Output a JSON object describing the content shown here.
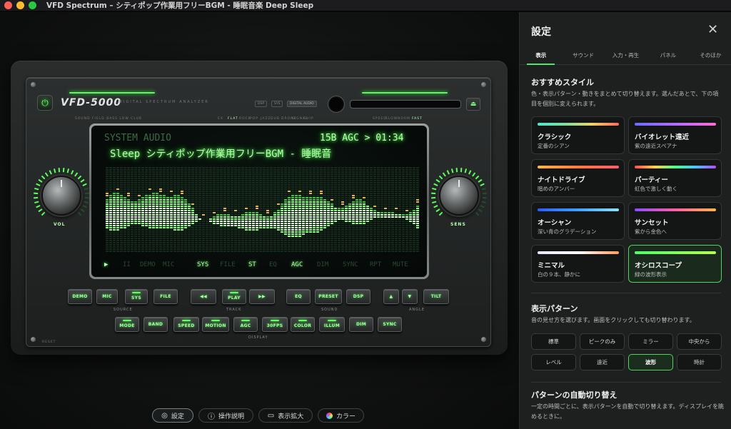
{
  "window": {
    "title": "VFD Spectrum – シティポップ作業用フリーBGM - 睡眠音楽 Deep Sleep"
  },
  "device": {
    "brand": "VFD-5000",
    "subtitle": "DIGITAL SPECTRUM ANALYZER",
    "header_chips": [
      "DSP",
      "SYS",
      "DIGITAL AUDIO"
    ],
    "left_micro": "SOUND FIELD  BASS  LOW  CLUB",
    "mid_micro": [
      "EX",
      "FLAT",
      "ROCK",
      "POP",
      "JAZZ",
      "DUB",
      "DRONE",
      "SIGNAL",
      "CHIP"
    ],
    "right_micro": [
      "SPEED",
      "SLOW",
      "NORM",
      "FAST"
    ],
    "reset_label": "RESET",
    "knob_left": "VOL",
    "knob_right": "SENS"
  },
  "vfd": {
    "source": "SYSTEM AUDIO",
    "band_info": "15B AGC > 01:34",
    "track": "Sleep  シティポップ作業用フリーBGM - 睡眠音",
    "status": [
      {
        "label": "▶",
        "on": true
      },
      {
        "label": "II",
        "on": false
      },
      {
        "label": "DEMO",
        "on": false
      },
      {
        "label": "MIC",
        "on": false
      },
      {
        "label": "SYS",
        "on": true
      },
      {
        "label": "FILE",
        "on": false
      },
      {
        "label": "ST",
        "on": true
      },
      {
        "label": "EQ",
        "on": false
      },
      {
        "label": "AGC",
        "on": true
      },
      {
        "label": "DIM",
        "on": false
      },
      {
        "label": "SYNC",
        "on": false
      },
      {
        "label": "RPT",
        "on": false
      },
      {
        "label": "MUTE",
        "on": false
      }
    ]
  },
  "controls": {
    "row1": [
      {
        "label": "DEMO",
        "lit": false
      },
      {
        "label": "MIC",
        "lit": false
      },
      {
        "label": "SYS",
        "lit": true
      },
      {
        "label": "FILE",
        "lit": false
      },
      {
        "label": "◀◀",
        "lit": false
      },
      {
        "label": "PLAY",
        "lit": true
      },
      {
        "label": "▶▶",
        "lit": false
      },
      {
        "label": "EQ",
        "lit": false
      },
      {
        "label": "PRESET",
        "lit": false
      },
      {
        "label": "DSP",
        "lit": false
      },
      {
        "label": "▲",
        "lit": false
      },
      {
        "label": "▼",
        "lit": false
      },
      {
        "label": "TILT",
        "lit": false
      }
    ],
    "row2": [
      {
        "label": "MODE",
        "lit": true
      },
      {
        "label": "BAND",
        "lit": false
      },
      {
        "label": "SPEED",
        "lit": true
      },
      {
        "label": "MOTION",
        "lit": true
      },
      {
        "label": "AGC",
        "lit": true
      },
      {
        "label": "30FPS",
        "lit": true
      },
      {
        "label": "COLOR",
        "lit": true
      },
      {
        "label": "ILLUM",
        "lit": true
      },
      {
        "label": "DIM",
        "lit": false
      },
      {
        "label": "SYNC",
        "lit": false
      }
    ],
    "groups": {
      "source": "SOURCE",
      "track": "TRACK",
      "sound": "SOUND",
      "angle": "ANGLE",
      "display": "DISPLAY"
    }
  },
  "toolbar": {
    "settings": "設定",
    "help": "操作説明",
    "zoom": "表示拡大",
    "color": "カラー"
  },
  "panel": {
    "title": "設定",
    "tabs": [
      "表示",
      "サウンド",
      "入力・再生",
      "パネル",
      "そのほか"
    ],
    "recommended": {
      "title": "おすすめスタイル",
      "desc": "色・表示パターン・動きをまとめて切り替えます。選んだあとで、下の項目を個別に変えられます。",
      "cards": [
        {
          "name": "クラシック",
          "desc": "定番のシアン",
          "gradient": "linear-gradient(90deg,#4ee6c9,#7de0a0,#f2d36b,#ff6b5b)",
          "active": false
        },
        {
          "name": "バイオレット遠近",
          "desc": "紫の遠近スペアナ",
          "gradient": "linear-gradient(90deg,#6b6bff,#b36bff,#ff6bd6)",
          "active": false
        },
        {
          "name": "ナイトドライブ",
          "desc": "暗めのアンバー",
          "gradient": "linear-gradient(90deg,#ffb347,#ff7a3d,#ff5a6e)",
          "active": false
        },
        {
          "name": "パーティー",
          "desc": "虹色で激しく動く",
          "gradient": "linear-gradient(90deg,#ff4d4d,#ffd24d,#4dff88,#4dc3ff,#b44dff)",
          "active": false
        },
        {
          "name": "オーシャン",
          "desc": "深い青のグラデーション",
          "gradient": "linear-gradient(90deg,#2b5cff,#3fa2ff,#8fe3ff)",
          "active": false
        },
        {
          "name": "サンセット",
          "desc": "紫から金色へ",
          "gradient": "linear-gradient(90deg,#8a4dff,#ff5fa2,#ffb547)",
          "active": false
        },
        {
          "name": "ミニマル",
          "desc": "白の９本、静かに",
          "gradient": "linear-gradient(90deg,#e6e6ff,#ffffff,#ff9a5a)",
          "active": false
        },
        {
          "name": "オシロスコープ",
          "desc": "緑の波形表示",
          "gradient": "linear-gradient(90deg,#4dff6a,#b6ff4d)",
          "active": true
        }
      ]
    },
    "pattern": {
      "title": "表示パターン",
      "desc": "音の見せ方を選びます。画面をクリックしても切り替わります。",
      "options": [
        "標準",
        "ピークのみ",
        "ミラー",
        "中央から",
        "レベル",
        "遠近",
        "波形",
        "時計"
      ],
      "active": "波形"
    },
    "auto": {
      "title": "パターンの自動切り替え",
      "desc": "一定の時間ごとに、表示パターンを自動で切り替えます。ディスプレイを眺めるときに。"
    }
  },
  "colors": {
    "accent": "#4fd462",
    "vfd_green": "#b8ffb0"
  }
}
